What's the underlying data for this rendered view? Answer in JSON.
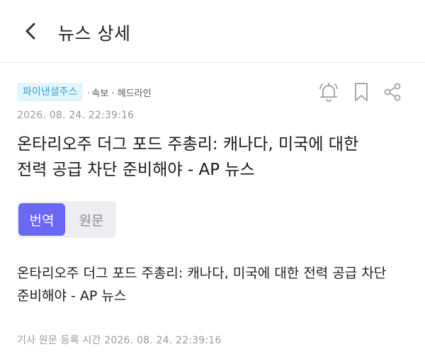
{
  "header": {
    "title": "뉴스 상세",
    "back_icon": "chevron-left-icon"
  },
  "article": {
    "source": "파이낸셜주스",
    "category": "속보 · 헤드라인",
    "timestamp": "2026. 08. 24. 22:39:16",
    "headline_lines": [
      "온타리오주 더그 포드 주총리: 캐나다, 미국에 대한",
      "전력 공급 차단 준비해야 - AP 뉴스"
    ],
    "body_lines": [
      "온타리오주 더그 포드 주총리: 캐나다, 미국에 대한 전력 공급 차단",
      "준비해야 - AP 뉴스"
    ],
    "registered_label": "기사 원문 등록 시간 2026. 08. 24. 22:39:16"
  },
  "actions": {
    "alarm_icon": "bell-icon",
    "bookmark_icon": "bookmark-icon",
    "share_icon": "share-icon"
  },
  "toggle": {
    "options": [
      "번역",
      "원문"
    ],
    "selected": "번역"
  },
  "colors": {
    "accent": "#6b67f5",
    "badge_bg": "#e3f5fc",
    "badge_text": "#2aa3d4",
    "muted_text": "#9a9a9a"
  }
}
